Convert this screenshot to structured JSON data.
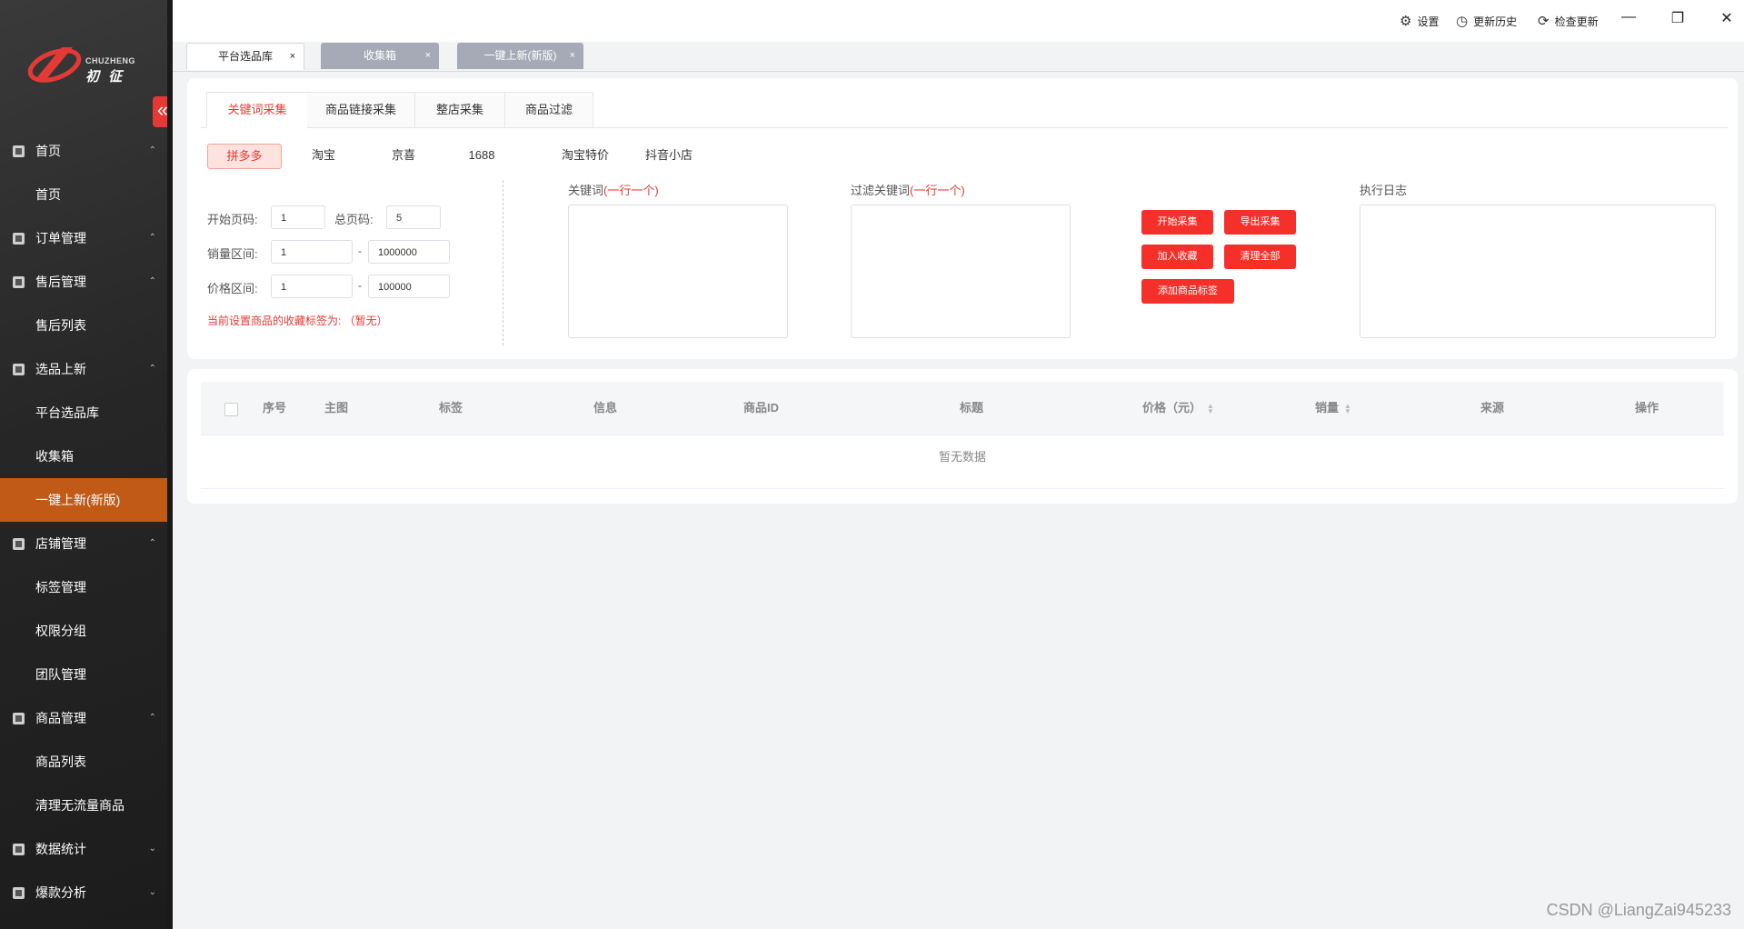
{
  "brand": {
    "name_en": "CHUZHENG",
    "name_cn": "初 征"
  },
  "sidebar": {
    "collapse_icon": "«",
    "items": [
      {
        "label": "首页",
        "type": "group",
        "icon": "chart-icon",
        "arrow": "^"
      },
      {
        "label": "首页",
        "type": "sub"
      },
      {
        "label": "订单管理",
        "type": "group",
        "icon": "document-icon",
        "arrow": "^"
      },
      {
        "label": "售后管理",
        "type": "group",
        "icon": "edit-icon",
        "arrow": "^"
      },
      {
        "label": "售后列表",
        "type": "sub"
      },
      {
        "label": "选品上新",
        "type": "group",
        "icon": "select-icon",
        "arrow": "^"
      },
      {
        "label": "平台选品库",
        "type": "sub"
      },
      {
        "label": "收集箱",
        "type": "sub"
      },
      {
        "label": "一键上新(新版)",
        "type": "sub",
        "active": true
      },
      {
        "label": "店铺管理",
        "type": "group",
        "icon": "store-icon",
        "arrow": "^"
      },
      {
        "label": "标签管理",
        "type": "sub"
      },
      {
        "label": "权限分组",
        "type": "sub"
      },
      {
        "label": "团队管理",
        "type": "sub"
      },
      {
        "label": "商品管理",
        "type": "group",
        "icon": "goods-icon",
        "arrow": "^"
      },
      {
        "label": "商品列表",
        "type": "sub"
      },
      {
        "label": "清理无流量商品",
        "type": "sub"
      },
      {
        "label": "数据统计",
        "type": "group",
        "icon": "stats-icon",
        "arrow": "v"
      },
      {
        "label": "爆款分析",
        "type": "group",
        "icon": "analysis-icon",
        "arrow": "v"
      }
    ]
  },
  "topbar": {
    "settings": "设置",
    "history": "更新历史",
    "check_update": "检查更新",
    "minimize": "—",
    "restore": "❐",
    "close": "✕"
  },
  "page_tabs": [
    {
      "label": "平台选品库",
      "active": true
    },
    {
      "label": "收集箱",
      "active": false
    },
    {
      "label": "一键上新(新版)",
      "active": false
    }
  ],
  "sub_tabs": [
    "关键词采集",
    "商品链接采集",
    "整店采集",
    "商品过滤"
  ],
  "platforms": [
    "拼多多",
    "淘宝",
    "京喜",
    "1688",
    "淘宝特价",
    "抖音小店"
  ],
  "form": {
    "start_page_label": "开始页码:",
    "start_page": "1",
    "total_page_label": "总页码:",
    "total_page": "5",
    "sales_label": "销量区间:",
    "sales_min": "1",
    "sales_max": "1000000",
    "price_label": "价格区间:",
    "price_min": "1",
    "price_max": "100000",
    "range_sep": "-",
    "tag_note": "当前设置商品的收藏标签为: （暂无）"
  },
  "keywords": {
    "label": "关键词",
    "hint": "(一行一个)"
  },
  "filter_keywords": {
    "label": "过滤关键词",
    "hint": "(一行一个)"
  },
  "log": {
    "label": "执行日志"
  },
  "actions": {
    "start": "开始采集",
    "export": "导出采集",
    "add_fav": "加入收藏",
    "clear_all": "清理全部",
    "add_tag": "添加商品标签"
  },
  "table": {
    "columns": [
      "序号",
      "主图",
      "标签",
      "信息",
      "商品ID",
      "标题",
      "价格（元）",
      "销量",
      "来源",
      "操作"
    ],
    "empty": "暂无数据"
  },
  "watermark": "CSDN @LiangZai945233",
  "colors": {
    "accent": "#e53935",
    "active_menu": "#c25a17",
    "inactive_tab": "#a6aab7"
  }
}
